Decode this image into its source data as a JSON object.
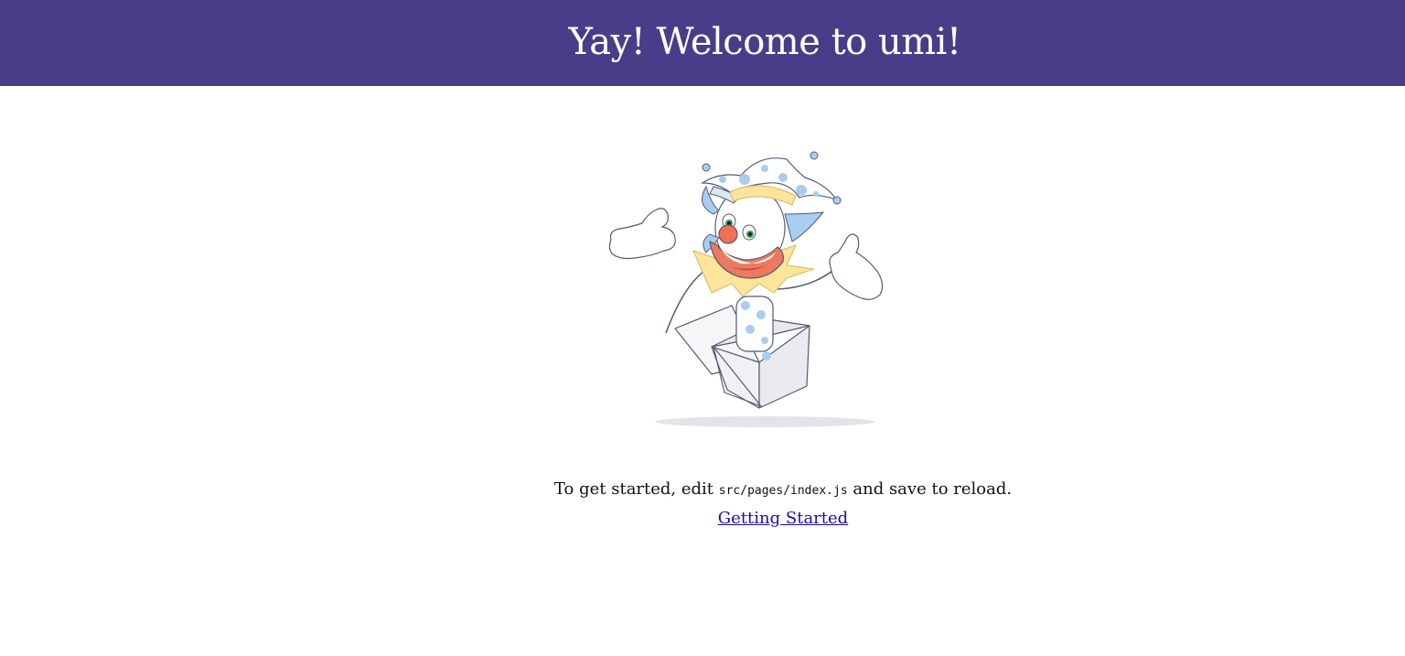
{
  "header": {
    "title": "Yay! Welcome to umi!",
    "background": "#493d8a"
  },
  "illustration": {
    "icon": "jack-in-the-box-clown-icon"
  },
  "main": {
    "intro_before": "To get started, edit ",
    "code_path": "src/pages/index.js",
    "intro_after": " and save to reload.",
    "link_label": "Getting Started",
    "link_color": "#1a0dab"
  }
}
